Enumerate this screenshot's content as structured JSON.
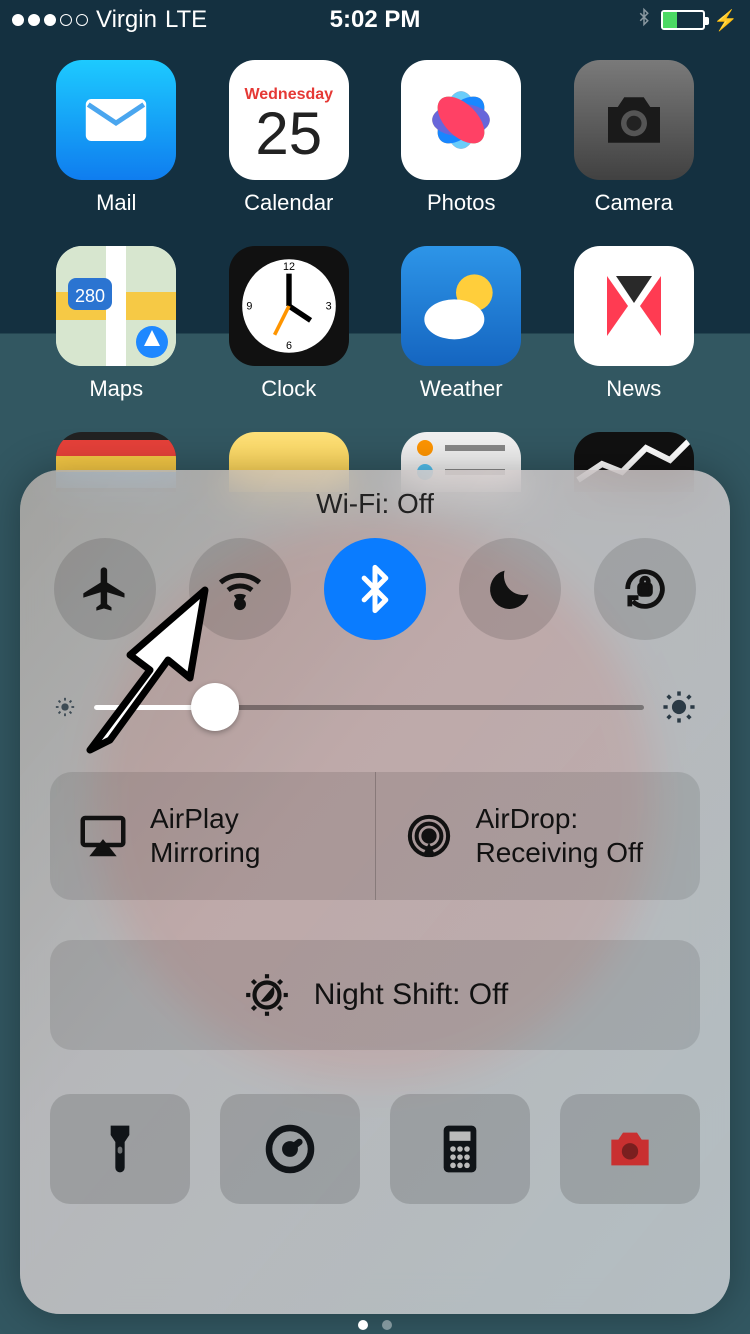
{
  "status": {
    "carrier": "Virgin",
    "network": "LTE",
    "time": "5:02 PM"
  },
  "apps": {
    "row1": [
      {
        "label": "Mail"
      },
      {
        "label": "Calendar",
        "dow": "Wednesday",
        "num": "25"
      },
      {
        "label": "Photos"
      },
      {
        "label": "Camera"
      }
    ],
    "row2": [
      {
        "label": "Maps"
      },
      {
        "label": "Clock"
      },
      {
        "label": "Weather"
      },
      {
        "label": "News"
      }
    ]
  },
  "cc": {
    "title": "Wi-Fi: Off",
    "airplay": "AirPlay Mirroring",
    "airdrop": "AirDrop: Receiving Off",
    "nightshift": "Night Shift: Off"
  }
}
